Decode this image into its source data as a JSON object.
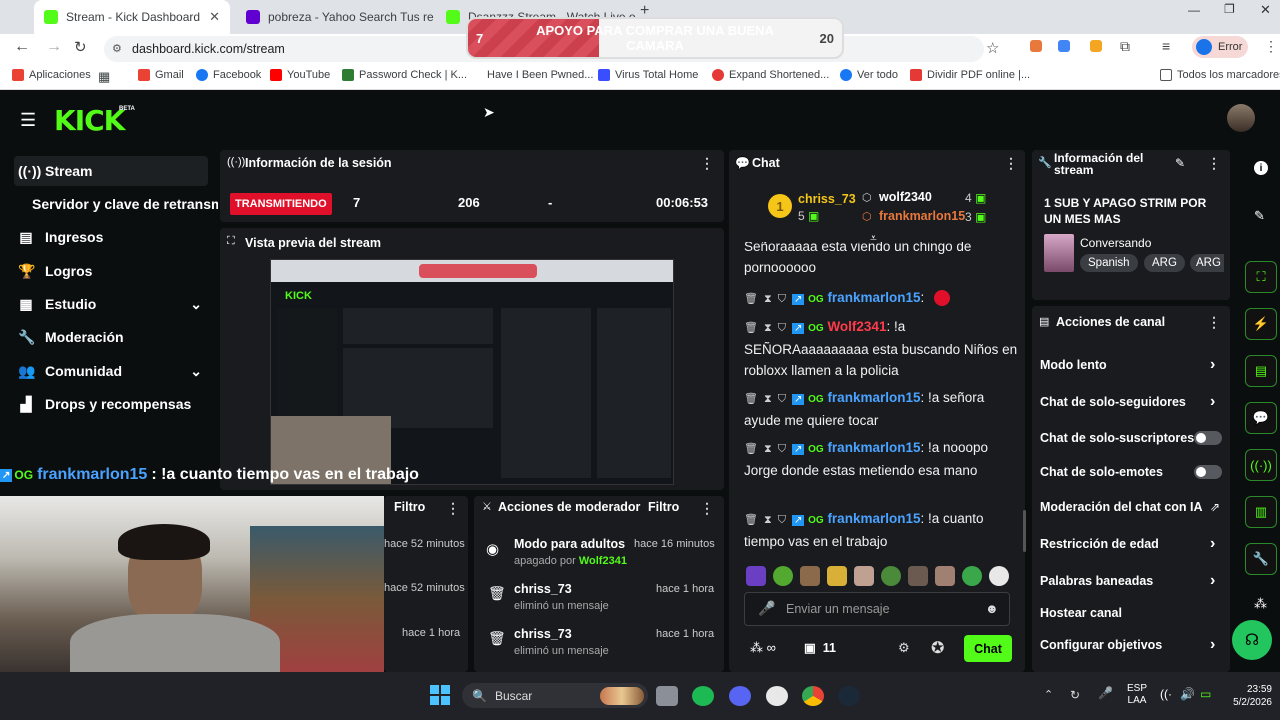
{
  "browser": {
    "tabs": [
      {
        "title": "Stream - Kick Dashboard",
        "color": "#53fc18"
      },
      {
        "title": "pobreza - Yahoo Search Tus re",
        "color": "#6001d2"
      },
      {
        "title": "Dsanzzz Stream - Watch Live on",
        "color": "#53fc18"
      }
    ],
    "url": "dashboard.kick.com/stream",
    "profile_label": "Error",
    "bookmarks": [
      "Aplicaciones",
      "Gmail",
      "Facebook",
      "YouTube",
      "Password Check | K...",
      "Have I Been Pwned...",
      "Virus Total Home",
      "Expand Shortened...",
      "Ver todo",
      "Dividir PDF online |...",
      "Todos los marcadores"
    ]
  },
  "goal": {
    "title": "APOYO PARA COMPRAR UNA BUENA CAMARA",
    "current": "7",
    "target": "20",
    "progress": 0.35
  },
  "app": {
    "logo": "KICK",
    "beta": "BETA"
  },
  "sidebar": {
    "items": [
      {
        "label": "Stream",
        "icon": "broadcast-icon"
      },
      {
        "label": "Servidor y clave de retransm",
        "icon": ""
      },
      {
        "label": "Ingresos",
        "icon": "chart-icon"
      },
      {
        "label": "Logros",
        "icon": "trophy-icon"
      },
      {
        "label": "Estudio",
        "icon": "studio-icon"
      },
      {
        "label": "Moderación",
        "icon": "wrench-icon"
      },
      {
        "label": "Comunidad",
        "icon": "people-icon"
      },
      {
        "label": "Drops y recompensas",
        "icon": "drops-icon"
      }
    ]
  },
  "session": {
    "title": "Información de la sesión",
    "status": "TRANSMITIENDO",
    "viewers": "7",
    "followers": "206",
    "subs": "-",
    "duration": "00:06:53"
  },
  "preview": {
    "title": "Vista previa del stream"
  },
  "overlay_chat": {
    "user": "frankmarlon15",
    "message": ": !a cuanto tiempo vas en el trabajo"
  },
  "mod_panel_left": {
    "filter": "Filtro",
    "times": [
      "hace 52 minutos",
      "hace 52 minutos",
      "hace 1 hora"
    ]
  },
  "mod_actions": {
    "title": "Acciones de moderador",
    "filter": "Filtro",
    "rows": [
      {
        "title": "Modo para adultos",
        "sub": "apagado por",
        "by": "Wolf2341",
        "time": "hace 16 minutos"
      },
      {
        "title": "chriss_73",
        "sub": "eliminó un mensaje",
        "by": "",
        "time": "hace 1 hora"
      },
      {
        "title": "chriss_73",
        "sub": "eliminó un mensaje",
        "by": "",
        "time": "hace 1 hora"
      }
    ]
  },
  "chat": {
    "title": "Chat",
    "leaderboard": [
      {
        "rank": "1",
        "name": "chriss_73",
        "count": "5"
      },
      {
        "rank": "2",
        "name": "wolf2340",
        "count": "4"
      },
      {
        "rank": "3",
        "name": "frankmarlon15",
        "count": "3"
      }
    ],
    "partial_message": "Señoraaaaa esta viendo un chingo de pornoooooo",
    "messages": [
      {
        "user": "frankmarlon15",
        "color": "#4aa3ff",
        "text": ""
      },
      {
        "user": "Wolf2341",
        "color": "#ff3b4a",
        "text": ": !a SEÑORAaaaaaaaaa esta buscando Niños en robloxx llamen a la policia"
      },
      {
        "user": "frankmarlon15",
        "color": "#4aa3ff",
        "text": ": !a señora ayude me quiere tocar"
      },
      {
        "user": "frankmarlon15",
        "color": "#4aa3ff",
        "text": ": !a nooopo Jorge donde estas metiendo esa mano"
      },
      {
        "user": "frankmarlon15",
        "color": "#4aa3ff",
        "text": ": !a cuanto tiempo vas en el trabajo"
      }
    ],
    "input_placeholder": "Enviar un mensaje",
    "points": "∞",
    "gift_count": "11",
    "send_label": "Chat"
  },
  "stream_info": {
    "title": "Información del stream",
    "stream_title": "1 SUB Y APAGO STRIM POR UN MES MAS",
    "category": "Conversando",
    "tags": [
      "Spanish",
      "ARG",
      "ARG"
    ]
  },
  "channel_actions": {
    "title": "Acciones de canal",
    "items": [
      {
        "label": "Modo lento",
        "type": "chevron"
      },
      {
        "label": "Chat de solo-seguidores",
        "type": "chevron"
      },
      {
        "label": "Chat de solo-suscriptores",
        "type": "toggle"
      },
      {
        "label": "Chat de solo-emotes",
        "type": "toggle"
      },
      {
        "label": "Moderación del chat con IA",
        "type": "external"
      },
      {
        "label": "Restricción de edad",
        "type": "chevron"
      },
      {
        "label": "Palabras baneadas",
        "type": "chevron"
      },
      {
        "label": "Hostear canal",
        "type": "none"
      },
      {
        "label": "Configurar objetivos",
        "type": "chevron"
      }
    ]
  },
  "taskbar": {
    "search": "Buscar",
    "lang": "ESP",
    "lang2": "LAA",
    "time": "23:59",
    "date": "5/2/2026"
  }
}
